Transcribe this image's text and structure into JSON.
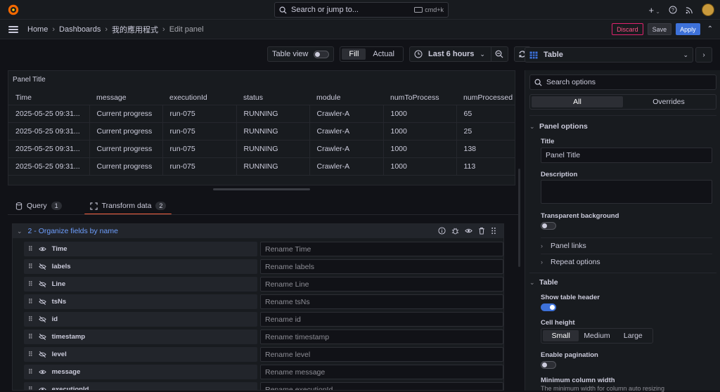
{
  "topbar": {
    "search_placeholder": "Search or jump to...",
    "shortcut": "cmd+k"
  },
  "breadcrumb": {
    "items": [
      "Home",
      "Dashboards",
      "我的應用程式",
      "Edit panel"
    ]
  },
  "actions": {
    "discard": "Discard",
    "save": "Save",
    "apply": "Apply"
  },
  "toolbar": {
    "table_view": "Table view",
    "fill": "Fill",
    "actual": "Actual",
    "time_range": "Last 6 hours"
  },
  "panel": {
    "title": "Panel Title",
    "columns": [
      "Time",
      "message",
      "executionId",
      "status",
      "module",
      "numToProcess",
      "numProcessed"
    ],
    "rows": [
      [
        "2025-05-25 09:31...",
        "Current progress",
        "run-075",
        "RUNNING",
        "Crawler-A",
        "1000",
        "65"
      ],
      [
        "2025-05-25 09:31...",
        "Current progress",
        "run-075",
        "RUNNING",
        "Crawler-A",
        "1000",
        "25"
      ],
      [
        "2025-05-25 09:31...",
        "Current progress",
        "run-075",
        "RUNNING",
        "Crawler-A",
        "1000",
        "138"
      ],
      [
        "2025-05-25 09:31...",
        "Current progress",
        "run-075",
        "RUNNING",
        "Crawler-A",
        "1000",
        "113"
      ]
    ]
  },
  "tabs": {
    "query": "Query",
    "query_count": "1",
    "transform": "Transform data",
    "transform_count": "2"
  },
  "transform": {
    "title": "2 - Organize fields by name",
    "fields": [
      {
        "name": "Time",
        "placeholder": "Rename Time",
        "visible": true
      },
      {
        "name": "labels",
        "placeholder": "Rename labels",
        "visible": false
      },
      {
        "name": "Line",
        "placeholder": "Rename Line",
        "visible": false
      },
      {
        "name": "tsNs",
        "placeholder": "Rename tsNs",
        "visible": false
      },
      {
        "name": "id",
        "placeholder": "Rename id",
        "visible": false
      },
      {
        "name": "timestamp",
        "placeholder": "Rename timestamp",
        "visible": false
      },
      {
        "name": "level",
        "placeholder": "Rename level",
        "visible": false
      },
      {
        "name": "message",
        "placeholder": "Rename message",
        "visible": true
      },
      {
        "name": "executionId",
        "placeholder": "Rename executionId",
        "visible": true
      }
    ]
  },
  "options": {
    "viz_type": "Table",
    "search_placeholder": "Search options",
    "all": "All",
    "overrides": "Overrides",
    "panel_options": "Panel options",
    "title_label": "Title",
    "title_value": "Panel Title",
    "description_label": "Description",
    "transparent_label": "Transparent background",
    "panel_links": "Panel links",
    "repeat_options": "Repeat options",
    "table_section": "Table",
    "show_header_label": "Show table header",
    "cell_height_label": "Cell height",
    "cell_heights": [
      "Small",
      "Medium",
      "Large"
    ],
    "pagination_label": "Enable pagination",
    "min_col_label": "Minimum column width",
    "min_col_desc": "The minimum width for column auto resizing"
  },
  "colors": {
    "apply": "#3d71d9",
    "discard": "#ff5286",
    "transform_title": "#6e9fff",
    "active_tab": "#f55f3e"
  }
}
